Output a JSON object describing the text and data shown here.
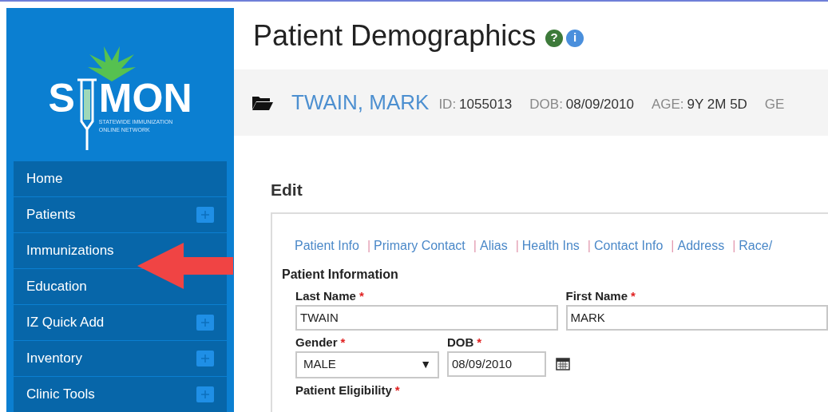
{
  "logo": {
    "left": "S",
    "right": "MON",
    "tagline": [
      "STATEWIDE IMMUNIZATION",
      "ONLINE NETWORK"
    ]
  },
  "sidebar": {
    "items": [
      {
        "label": "Home",
        "expandable": false
      },
      {
        "label": "Patients",
        "expandable": true
      },
      {
        "label": "Immunizations",
        "expandable": false
      },
      {
        "label": "Education",
        "expandable": false
      },
      {
        "label": "IZ Quick Add",
        "expandable": true
      },
      {
        "label": "Inventory",
        "expandable": true
      },
      {
        "label": "Clinic Tools",
        "expandable": true
      }
    ]
  },
  "page": {
    "title": "Patient Demographics",
    "help_icons": [
      {
        "glyph": "?",
        "color": "#3d7a3a"
      },
      {
        "glyph": "i",
        "color": "#4a8fdc"
      }
    ]
  },
  "patient_bar": {
    "name": "TWAIN, MARK",
    "fields": [
      {
        "label": "ID:",
        "value": "1055013"
      },
      {
        "label": "DOB:",
        "value": "08/09/2010"
      },
      {
        "label": "AGE:",
        "value": "9Y 2M 5D"
      },
      {
        "label": "GE"
      }
    ]
  },
  "edit": {
    "heading": "Edit",
    "separator": "|",
    "links": [
      "Patient Info",
      "Primary Contact",
      "Alias",
      "Health Ins",
      "Contact Info",
      "Address",
      "Race/"
    ],
    "section_title": "Patient Information",
    "required_mark": "*",
    "rows": [
      [
        {
          "kind": "text",
          "label": "Last Name",
          "required": true,
          "value": "TWAIN"
        },
        {
          "kind": "text",
          "label": "First Name",
          "required": true,
          "value": "MARK"
        }
      ],
      [
        {
          "kind": "select",
          "label": "Gender",
          "required": true,
          "value": "MALE",
          "caret": "▼"
        },
        {
          "kind": "date",
          "label": "DOB",
          "required": true,
          "value": "08/09/2010"
        }
      ],
      [
        {
          "kind": "heading",
          "label": "Patient Eligibility",
          "required": true
        }
      ]
    ]
  }
}
